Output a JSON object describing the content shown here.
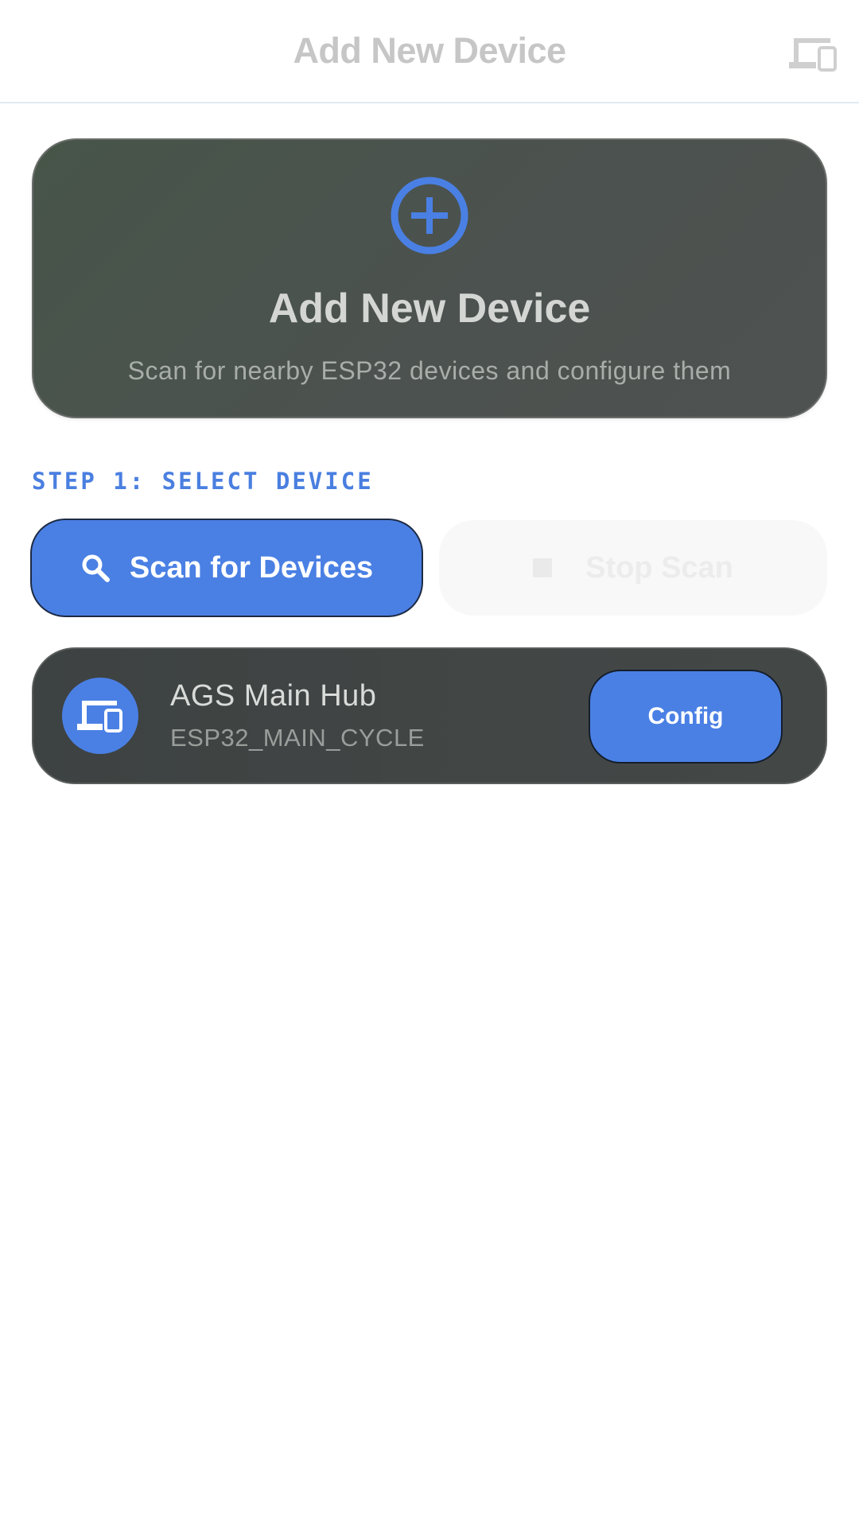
{
  "header": {
    "title": "Add New Device",
    "device_icon": "devices-icon"
  },
  "hero": {
    "icon": "add-circle-icon",
    "title": "Add New Device",
    "subtitle": "Scan for nearby ESP32 devices and configure them"
  },
  "step": {
    "label": "STEP 1: SELECT DEVICE"
  },
  "actions": {
    "scan_label": "Scan for Devices",
    "scan_icon": "search-icon",
    "stop_label": "Stop Scan",
    "stop_icon": "stop-icon",
    "stop_enabled": false
  },
  "devices": [
    {
      "name": "AGS Main Hub",
      "id": "ESP32_MAIN_CYCLE",
      "icon": "devices-icon",
      "action_label": "Config"
    }
  ],
  "colors": {
    "accent": "#4a80e4",
    "card_dark": "#434847",
    "hero_card": "#4c524f"
  }
}
